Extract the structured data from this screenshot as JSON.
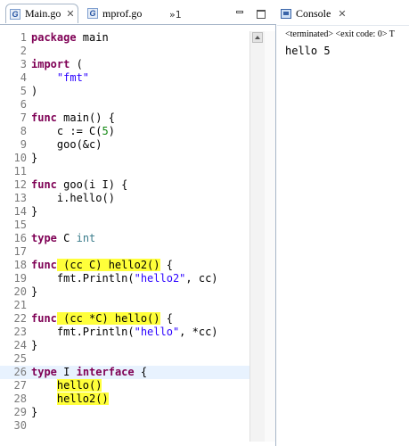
{
  "editor": {
    "tabs": [
      {
        "label": "Main.go",
        "icon": "go-file-icon"
      },
      {
        "label": "mprof.go",
        "icon": "go-file-icon"
      }
    ],
    "overflow_label": "»1"
  },
  "console": {
    "title": "Console",
    "status": "<terminated> <exit code: 0> T",
    "output": "hello 5"
  },
  "code": [
    {
      "n": "1",
      "html": "<span class='kw'>package</span> main"
    },
    {
      "n": "2",
      "html": ""
    },
    {
      "n": "3",
      "html": "<span class='kw'>import</span> ("
    },
    {
      "n": "4",
      "html": "    <span class='str'>\"fmt\"</span>"
    },
    {
      "n": "5",
      "html": ")"
    },
    {
      "n": "6",
      "html": ""
    },
    {
      "n": "7",
      "html": "<span class='kw'>func</span> main() {"
    },
    {
      "n": "8",
      "html": "    c := C(<span class='num'>5</span>)"
    },
    {
      "n": "9",
      "html": "    goo(&amp;c)"
    },
    {
      "n": "10",
      "html": "}"
    },
    {
      "n": "11",
      "html": ""
    },
    {
      "n": "12",
      "html": "<span class='kw'>func</span> goo(i I) {"
    },
    {
      "n": "13",
      "html": "    i.hello()"
    },
    {
      "n": "14",
      "html": "}"
    },
    {
      "n": "15",
      "html": ""
    },
    {
      "n": "16",
      "html": "<span class='kw'>type</span> C <span class='typ'>int</span>"
    },
    {
      "n": "17",
      "html": ""
    },
    {
      "n": "18",
      "html": "<span class='kw'>func</span><span class='hl'> (cc C) hello2()</span> {"
    },
    {
      "n": "19",
      "html": "    fmt.Println(<span class='str'>\"hello2\"</span>, cc)"
    },
    {
      "n": "20",
      "html": "}"
    },
    {
      "n": "21",
      "html": ""
    },
    {
      "n": "22",
      "html": "<span class='kw'>func</span><span class='hl'> (cc *C) hello()</span> {"
    },
    {
      "n": "23",
      "html": "    fmt.Println(<span class='str'>\"hello\"</span>, *cc)"
    },
    {
      "n": "24",
      "html": "}"
    },
    {
      "n": "25",
      "html": ""
    },
    {
      "n": "26",
      "html": "<span class='kw'>type</span> I <span class='kw'>interface</span> {"
    },
    {
      "n": "27",
      "html": "    <span class='hl'>hello()</span>"
    },
    {
      "n": "28",
      "html": "    <span class='hl'>hello2()</span>"
    },
    {
      "n": "29",
      "html": "}"
    },
    {
      "n": "30",
      "html": ""
    }
  ],
  "current_line": "26"
}
